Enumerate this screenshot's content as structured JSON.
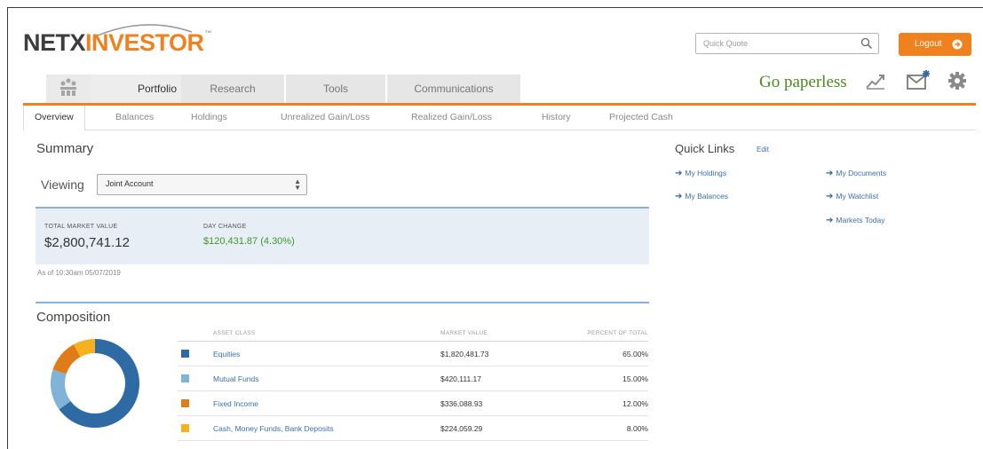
{
  "brand": {
    "logo_part1": "NETX",
    "logo_part2": "INVESTOR",
    "trademark": "™"
  },
  "header": {
    "search_placeholder": "Quick Quote",
    "logout_label": "Logout",
    "go_paperless": "Go paperless"
  },
  "tabs": {
    "main": [
      {
        "label": "Portfolio",
        "active": true
      },
      {
        "label": "Research"
      },
      {
        "label": "Tools"
      },
      {
        "label": "Communications"
      }
    ],
    "sub": [
      {
        "label": "Overview",
        "active": true
      },
      {
        "label": "Balances"
      },
      {
        "label": "Holdings"
      },
      {
        "label": "Unrealized Gain/Loss"
      },
      {
        "label": "Realized Gain/Loss"
      },
      {
        "label": "History"
      },
      {
        "label": "Projected Cash"
      }
    ]
  },
  "summary": {
    "title": "Summary",
    "viewing_label": "Viewing",
    "account_selected": "Joint Account",
    "total_market_value_label": "TOTAL MARKET VALUE",
    "total_market_value": "$2,800,741.12",
    "day_change_label": "DAY CHANGE",
    "day_change": "$120,431.87 (4.30%)",
    "as_of": "As of 10:30am 05/07/2019"
  },
  "composition": {
    "title": "Composition",
    "headers": {
      "asset_class": "ASSET CLASS",
      "market_value": "MARKET VALUE",
      "percent": "PERCENT OF TOTAL"
    },
    "rows": [
      {
        "name": "Equities",
        "market_value": "$1,820,481.73",
        "percent": "65.00%",
        "color": "#2e6aa4"
      },
      {
        "name": "Mutual Funds",
        "market_value": "$420,111.17",
        "percent": "15.00%",
        "color": "#7fb3d8"
      },
      {
        "name": "Fixed Income",
        "market_value": "$336,088.93",
        "percent": "12.00%",
        "color": "#e07b1a"
      },
      {
        "name": "Cash, Money Funds, Bank Deposits",
        "market_value": "$224,059.29",
        "percent": "8.00%",
        "color": "#f6b21c"
      }
    ]
  },
  "quick_links": {
    "title": "Quick Links",
    "edit_label": "Edit",
    "col1": [
      "My Holdings",
      "My Balances"
    ],
    "col2": [
      "My Documents",
      "My Watchlist",
      "Markets Today"
    ]
  },
  "colors": {
    "accent": "#f0811f",
    "link": "#3b6fa8",
    "positive": "#3b9a28",
    "summary_bg": "#e7eef6"
  }
}
